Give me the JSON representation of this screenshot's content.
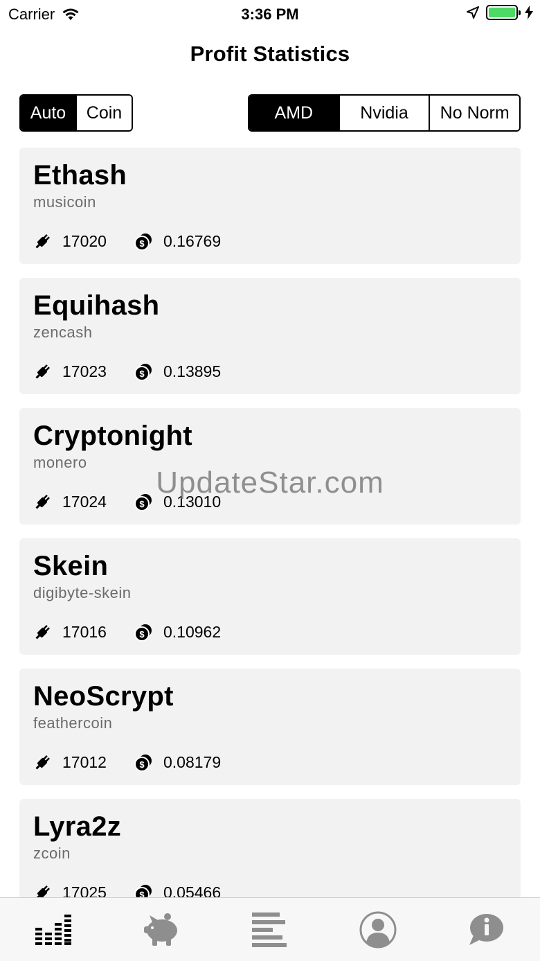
{
  "status_bar": {
    "carrier": "Carrier",
    "time": "3:36 PM",
    "battery_color": "#4cd964"
  },
  "nav": {
    "title": "Profit Statistics"
  },
  "mode_segment": {
    "options": [
      "Auto",
      "Coin"
    ],
    "selected": "Auto"
  },
  "gpu_segment": {
    "options": [
      "AMD",
      "Nvidia",
      "No Norm"
    ],
    "selected": "AMD"
  },
  "algorithms": [
    {
      "name": "Ethash",
      "coin": "musicoin",
      "plug_value": "17020",
      "coin_value": "0.16769"
    },
    {
      "name": "Equihash",
      "coin": "zencash",
      "plug_value": "17023",
      "coin_value": "0.13895"
    },
    {
      "name": "Cryptonight",
      "coin": "monero",
      "plug_value": "17024",
      "coin_value": "0.13010"
    },
    {
      "name": "Skein",
      "coin": "digibyte-skein",
      "plug_value": "17016",
      "coin_value": "0.10962"
    },
    {
      "name": "NeoScrypt",
      "coin": "feathercoin",
      "plug_value": "17012",
      "coin_value": "0.08179"
    },
    {
      "name": "Lyra2z",
      "coin": "zcoin",
      "plug_value": "17025",
      "coin_value": "0.05466"
    }
  ],
  "watermark": "UpdateStar.com",
  "tab_bar": {
    "items": [
      {
        "icon": "statistics-icon",
        "selected": true
      },
      {
        "icon": "piggy-bank-icon",
        "selected": false
      },
      {
        "icon": "list-icon",
        "selected": false
      },
      {
        "icon": "profile-icon",
        "selected": false
      },
      {
        "icon": "info-icon",
        "selected": false
      }
    ],
    "active_color": "#000000",
    "inactive_color": "#8e8e8e"
  }
}
